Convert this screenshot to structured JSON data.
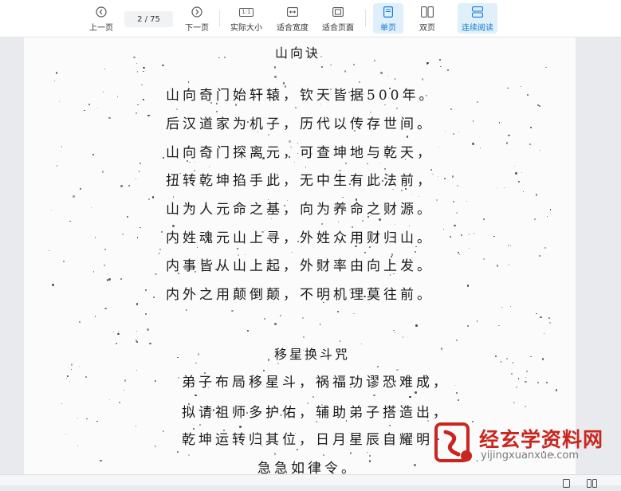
{
  "toolbar": {
    "prev_label": "上一页",
    "page_indicator": "2 / 75",
    "next_label": "下一页",
    "actual_size_label": "实际大小",
    "fit_width_label": "适合宽度",
    "fit_page_label": "适合页面",
    "single_page_label": "单页",
    "double_page_label": "双页",
    "continuous_label": "连续阅读",
    "actual_size_icon_text": "1:1",
    "accent_color": "#1677d9",
    "active_bg": "#dff0fb",
    "icons": [
      "chevron-left-circle-icon",
      "chevron-right-circle-icon",
      "actual-size-icon",
      "fit-width-icon",
      "fit-page-icon",
      "single-page-icon",
      "double-page-icon",
      "continuous-icon"
    ],
    "active_modes": [
      "单页",
      "连续阅读"
    ]
  },
  "document": {
    "poem1_title": "山向诀",
    "poem1_lines": [
      "山向奇门始轩辕，钦天皆据500年。",
      "后汉道家为机子，历代以传存世间。",
      "山向奇门探离元，可查坤地与乾天，",
      "扭转乾坤掐手此，无中生有此法前，",
      "山为人元命之基，向为养命之财源。",
      "内姓魂元山上寻，外姓众用财归山。",
      "内事皆从山上起，外财率由向上发。",
      "内外之用颠倒颠，不明机理莫往前。"
    ],
    "poem2_title": "移星换斗咒",
    "poem2_lines": [
      "弟子布局移星斗，祸福功谬恐难成，",
      "拟请祖师多护佑，辅助弟子搭造出，",
      "乾坤运转归其位，日月星辰自耀明，",
      "急急如律令。"
    ]
  },
  "watermark": {
    "title": "经玄学资料网",
    "url": "yijingxuanxue.com",
    "brand_color": "#c8261f"
  }
}
